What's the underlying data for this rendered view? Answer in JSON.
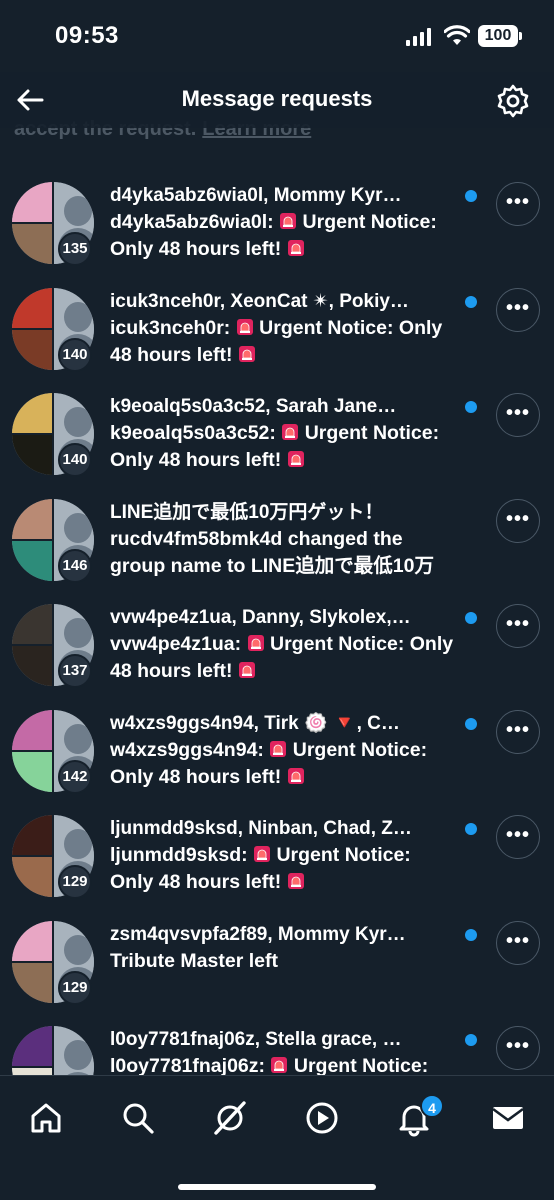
{
  "status_bar": {
    "time": "09:53",
    "battery": "100"
  },
  "header": {
    "title": "Message requests",
    "notice_text": "accept the request.",
    "notice_link": "Learn more"
  },
  "requests": [
    {
      "names": "d4yka5abz6wia0l, Mommy Kyr…",
      "preview_prefix": "d4yka5abz6wia0l:",
      "preview_body": "Urgent Notice: Only 48 hours left!",
      "count": "135",
      "unread": true,
      "siren": true
    },
    {
      "names": "icuk3nceh0r, XeonCat ✴, Pokiy…",
      "preview_prefix": "icuk3nceh0r:",
      "preview_body": "Urgent Notice: Only 48 hours left!",
      "count": "140",
      "unread": true,
      "siren": true
    },
    {
      "names": "k9eoalq5s0a3c52, Sarah Jane…",
      "preview_prefix": "k9eoalq5s0a3c52:",
      "preview_body": "Urgent Notice: Only 48 hours left!",
      "count": "140",
      "unread": true,
      "siren": true
    },
    {
      "names": "LINE追加で最低10万円ゲット！",
      "preview_prefix": "",
      "preview_body": "rucdv4fm58bmk4d changed the group name to LINE追加で最低10万",
      "count": "146",
      "unread": false,
      "siren": false
    },
    {
      "names": "vvw4pe4z1ua, Danny, Slykolex,…",
      "preview_prefix": "vvw4pe4z1ua:",
      "preview_body": "Urgent Notice: Only 48 hours left!",
      "count": "137",
      "unread": true,
      "siren": true
    },
    {
      "names": "w4xzs9ggs4n94, Tirk 🍥 🔻, C…",
      "preview_prefix": "w4xzs9ggs4n94:",
      "preview_body": "Urgent Notice: Only 48 hours left!",
      "count": "142",
      "unread": true,
      "siren": true
    },
    {
      "names": "ljunmdd9sksd, Ninban, Chad, Z…",
      "preview_prefix": "ljunmdd9sksd:",
      "preview_body": "Urgent Notice: Only 48 hours left!",
      "count": "129",
      "unread": true,
      "siren": true
    },
    {
      "names": "zsm4qvsvpfa2f89, Mommy Kyr…",
      "preview_prefix": "",
      "preview_body": "Tribute Master left",
      "count": "129",
      "unread": true,
      "siren": false
    },
    {
      "names": "l0oy7781fnaj06z, Stella grace, …",
      "preview_prefix": "l0oy7781fnaj06z:",
      "preview_body": "Urgent Notice:",
      "count": "",
      "unread": true,
      "siren": true
    }
  ],
  "more_label": "•••",
  "tab_bar": {
    "items": [
      "home-icon",
      "search-icon",
      "grok-icon",
      "video-icon",
      "bell-icon",
      "mail-icon"
    ],
    "notifications_badge": "4"
  },
  "colors": {
    "background": "#15202b",
    "accent": "#1d9bf0",
    "text": "#ffffff"
  },
  "avatar_palettes": [
    [
      "#e8a6c4",
      "#8d6e55"
    ],
    [
      "#c0392b",
      "#7a3b26"
    ],
    [
      "#d8b25a",
      "#1b1b14"
    ],
    [
      "#b98a74",
      "#2d8c7a"
    ],
    [
      "#3a3530",
      "#2a241f"
    ],
    [
      "#c46aa6",
      "#86d39a"
    ],
    [
      "#3b1d18",
      "#9a6a4c"
    ],
    [
      "#e8a6c4",
      "#8d6e55"
    ],
    [
      "#5b2f7d",
      "#e6e2d6"
    ]
  ]
}
